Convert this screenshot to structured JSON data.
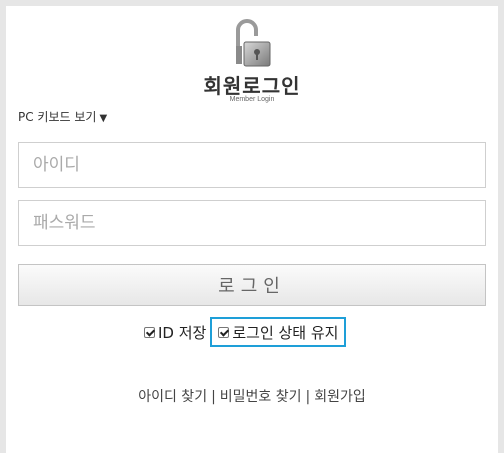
{
  "header": {
    "title": "회원로그인",
    "subtitle": "Member Login"
  },
  "keyboard": {
    "label": "PC 키보드 보기",
    "arrow": "▼"
  },
  "form": {
    "id_placeholder": "아이디",
    "pw_placeholder": "패스워드",
    "login_label": "로그인"
  },
  "options": {
    "save_id_label": "ID 저장",
    "keep_login_label": "로그인 상태 유지",
    "save_id_checked": true,
    "keep_login_checked": true
  },
  "links": {
    "find_id": "아이디 찾기",
    "find_pw": "비밀번호 찾기",
    "join": "회원가입",
    "separator": "|"
  },
  "colors": {
    "highlight": "#1e9fd8"
  }
}
